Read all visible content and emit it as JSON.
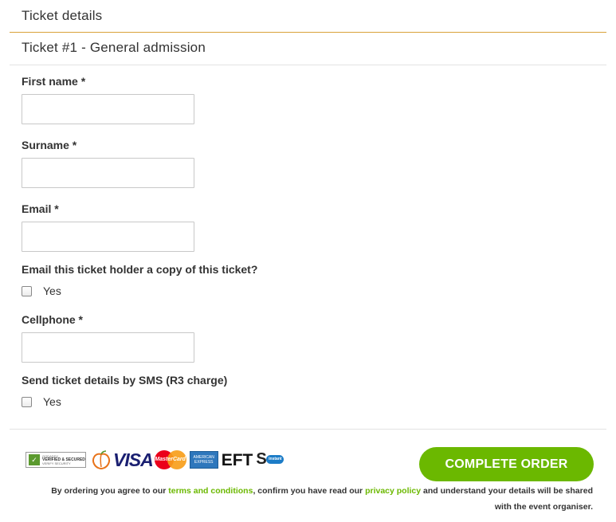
{
  "section": {
    "title": "Ticket details"
  },
  "ticket": {
    "title": "Ticket #1 - General admission"
  },
  "fields": {
    "first_name": {
      "label": "First name *",
      "value": ""
    },
    "surname": {
      "label": "Surname *",
      "value": ""
    },
    "email": {
      "label": "Email *",
      "value": ""
    },
    "email_copy": {
      "question": "Email this ticket holder a copy of this ticket?",
      "option_label": "Yes",
      "checked": false
    },
    "cellphone": {
      "label": "Cellphone *",
      "value": ""
    },
    "sms": {
      "question": "Send ticket details by SMS (R3 charge)",
      "option_label": "Yes",
      "checked": false
    }
  },
  "badges": {
    "godaddy": {
      "line1": "GODADDY",
      "line2": "VERIFIED & SECURED",
      "line3": "VERIFY SECURITY"
    },
    "visa": "VISA",
    "mastercard": "MasterCard",
    "amex": {
      "line1": "AMERICAN",
      "line2": "EXPRESS"
    },
    "eft": "EFT",
    "sid": {
      "letter": "S",
      "pill": "instant EFT"
    }
  },
  "actions": {
    "complete_label": "COMPLETE ORDER"
  },
  "terms": {
    "prefix": "By ordering you agree to our ",
    "terms_link": "terms and conditions",
    "middle": ", confirm you have read our ",
    "privacy_link": "privacy policy",
    "suffix": " and understand your details will be shared with the event organiser."
  },
  "colors": {
    "accent_green": "#6bb800",
    "rule_orange": "#d9a23a"
  }
}
